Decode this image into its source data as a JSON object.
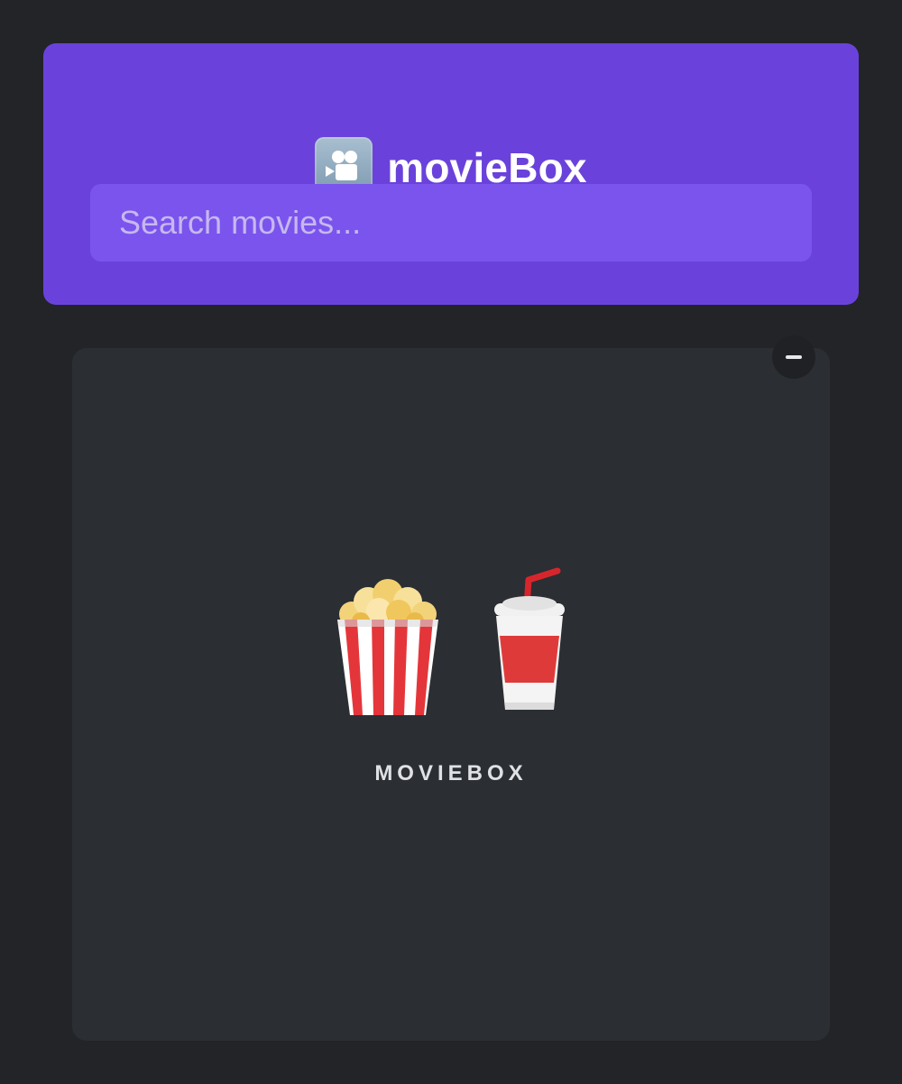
{
  "header": {
    "brand_icon": "movie-camera-icon",
    "title": "movieBox",
    "background": "#6a42db"
  },
  "search": {
    "placeholder": "Search movies...",
    "value": ""
  },
  "card": {
    "close_icon": "minus-icon",
    "icons": [
      "popcorn-icon",
      "soft-drink-cup-icon"
    ],
    "label": "MOVIEBOX"
  }
}
